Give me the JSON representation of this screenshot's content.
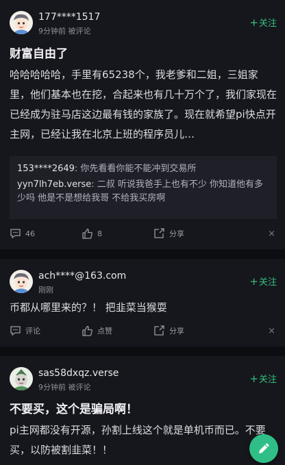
{
  "posts": [
    {
      "username": "177****1517",
      "time": "9分钟前",
      "status": "被评论",
      "follow_label": "关注",
      "title": "财富自由了",
      "body": "哈哈哈哈哈，手里有65238个，我老爹和二姐，三姐家里，他们基本也在挖，合起来也有几十万个了，我们家现在已经成为驻马店这边最有钱的家族了。现在就希望pi快点开主网，已经让我在北京上班的程序员儿…",
      "replies": [
        {
          "user": "153****2649",
          "text": "你先看看你能不能冲到交易所"
        },
        {
          "user": "yyn7lh7eb.verse",
          "text": "二叔  听说我爸手上也有不少 你知道他有多少吗 他是不是想给我哥  不给我买房啊"
        }
      ],
      "comment_count": "46",
      "like_count": "8",
      "share_label": "分享",
      "close_label": "×"
    },
    {
      "username": "ach****@163.com",
      "time": "刚刚",
      "status": "",
      "follow_label": "关注",
      "body": "币都从哪里来的？！ 把韭菜当猴耍",
      "comment_label": "评论",
      "like_label": "点赞",
      "share_label": "分享",
      "close_label": "×"
    },
    {
      "username": "sas58dxqz.verse",
      "time": "9分钟前",
      "status": "被评论",
      "follow_label": "关注",
      "title": "不要买，这个是骗局啊！",
      "body": "pi主网都没有开源，孙割上线这个就是单机币而已。不要买，以防被割韭菜！！"
    }
  ],
  "fab": {
    "icon": "pencil-icon"
  },
  "colors": {
    "accent": "#33c07b",
    "background": "#0c0d11",
    "card": "#16171d"
  }
}
